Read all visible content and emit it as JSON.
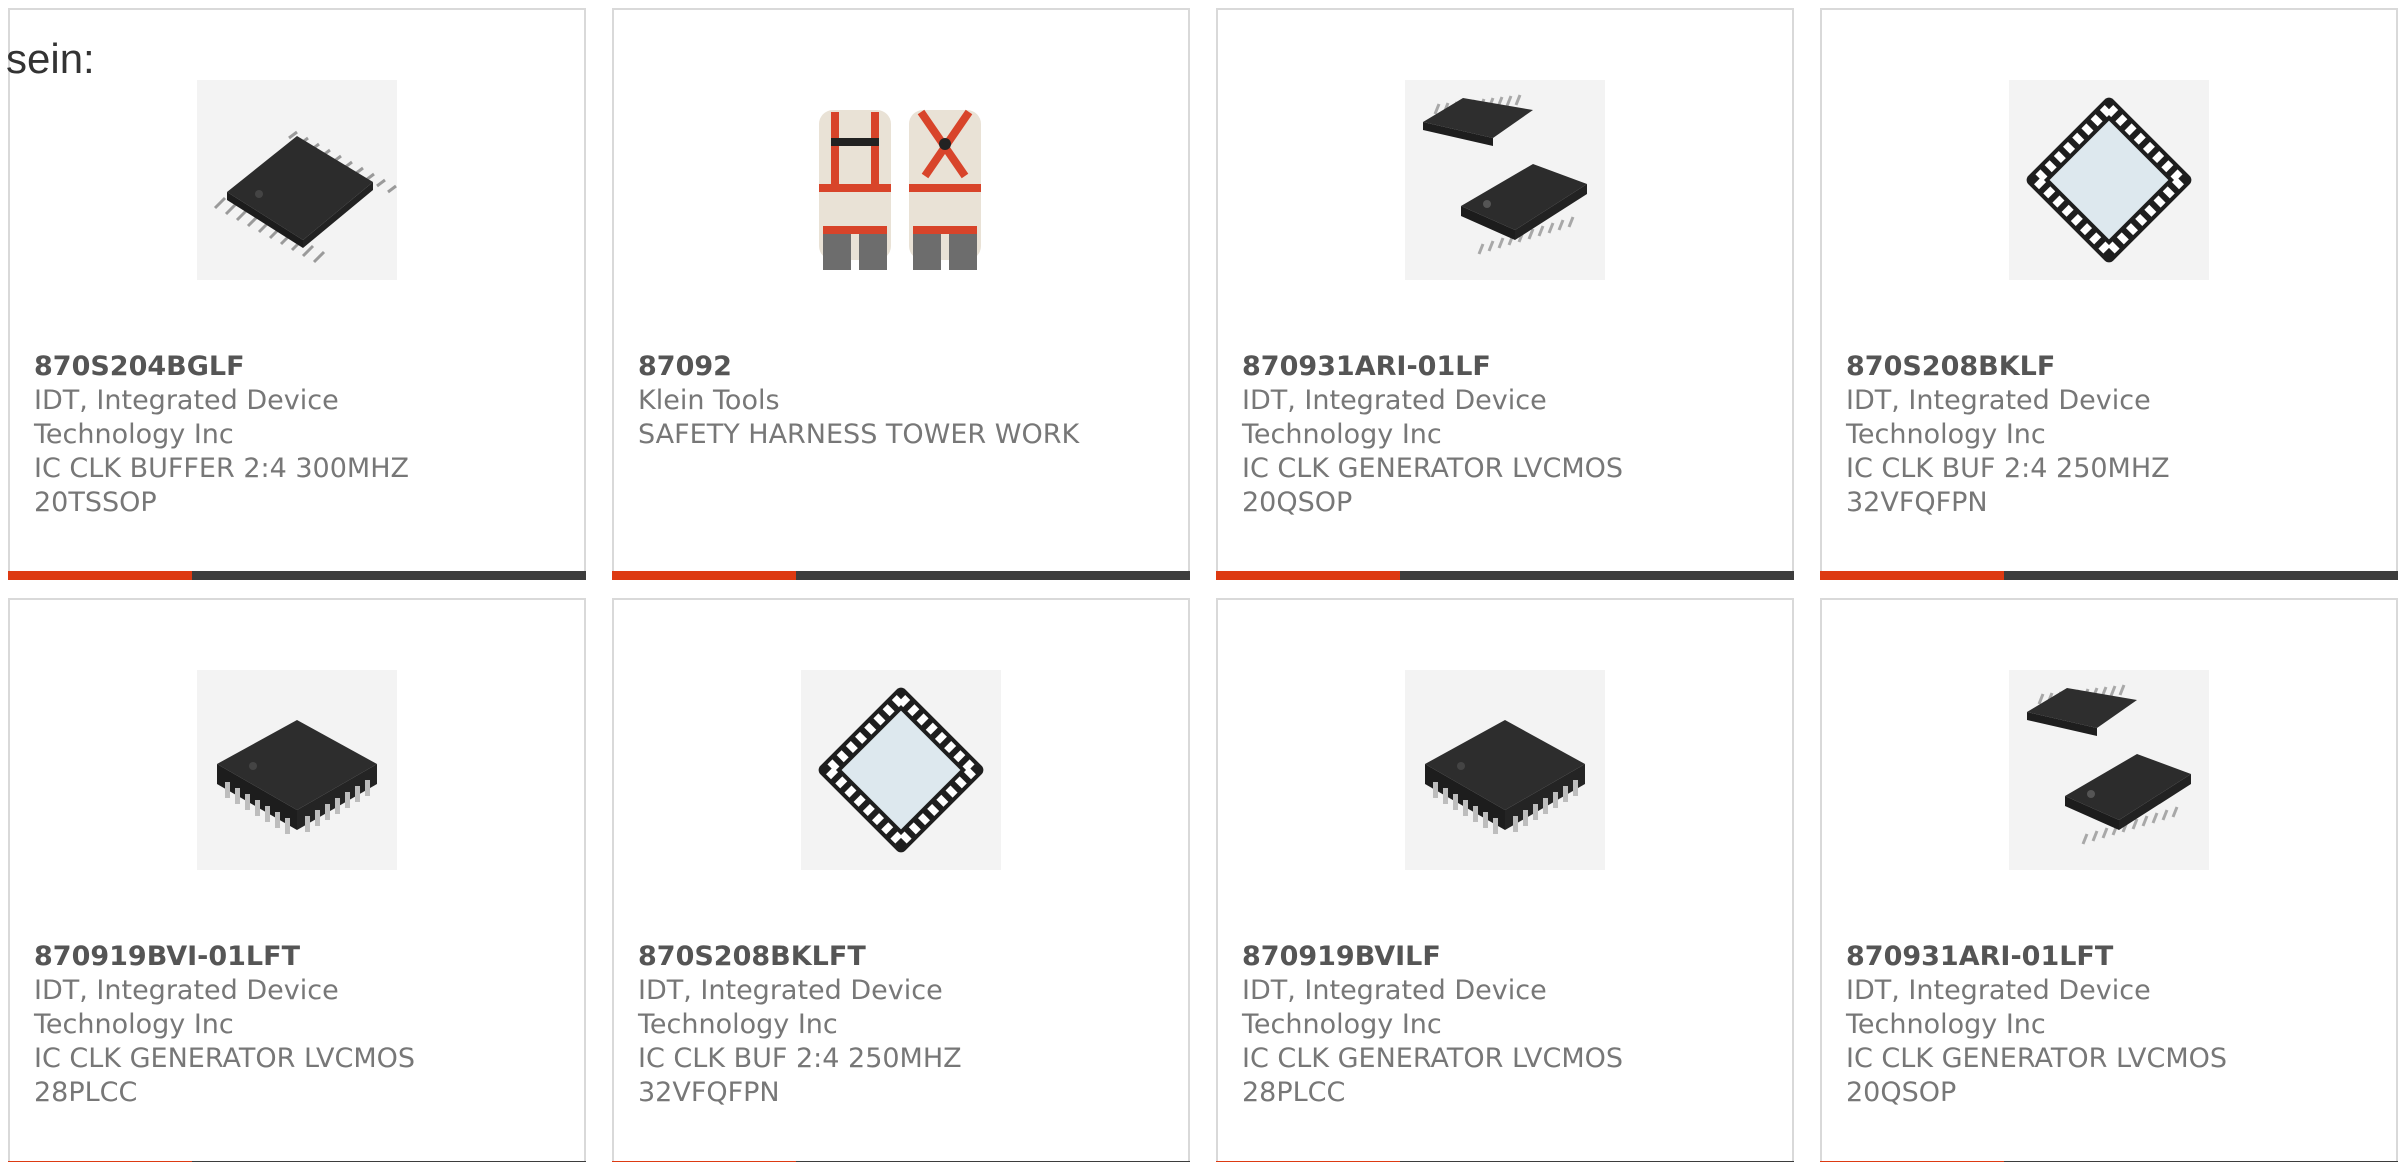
{
  "intro_text": "sein:",
  "colors": {
    "accent": "#dd3a12",
    "bar": "#3d3d3d",
    "border": "#d9d9d9",
    "text": "#777777"
  },
  "products": [
    {
      "mpn": "870S204BGLF",
      "manufacturer_l1": "IDT, Integrated Device",
      "manufacturer_l2": "Technology Inc",
      "desc_l1": "IC CLK BUFFER 2:4 300MHZ",
      "desc_l2": "20TSSOP",
      "image": "tssop-chip-icon"
    },
    {
      "mpn": "87092",
      "manufacturer_l1": "Klein Tools",
      "manufacturer_l2": "",
      "desc_l1": "SAFETY HARNESS TOWER WORK",
      "desc_l2": "",
      "image": "safety-harness-icon"
    },
    {
      "mpn": "870931ARI-01LF",
      "manufacturer_l1": "IDT, Integrated Device",
      "manufacturer_l2": "Technology Inc",
      "desc_l1": "IC CLK GENERATOR LVCMOS",
      "desc_l2": "20QSOP",
      "image": "qsop-chip-icon"
    },
    {
      "mpn": "870S208BKLF",
      "manufacturer_l1": "IDT, Integrated Device",
      "manufacturer_l2": "Technology Inc",
      "desc_l1": "IC CLK BUF 2:4 250MHZ",
      "desc_l2": "32VFQFPN",
      "image": "qfn-chip-icon"
    },
    {
      "mpn": "870919BVI-01LFT",
      "manufacturer_l1": "IDT, Integrated Device",
      "manufacturer_l2": "Technology Inc",
      "desc_l1": "IC CLK GENERATOR LVCMOS",
      "desc_l2": "28PLCC",
      "image": "plcc-chip-icon"
    },
    {
      "mpn": "870S208BKLFT",
      "manufacturer_l1": "IDT, Integrated Device",
      "manufacturer_l2": "Technology Inc",
      "desc_l1": "IC CLK BUF 2:4 250MHZ",
      "desc_l2": "32VFQFPN",
      "image": "qfn-chip-icon"
    },
    {
      "mpn": "870919BVILF",
      "manufacturer_l1": "IDT, Integrated Device",
      "manufacturer_l2": "Technology Inc",
      "desc_l1": "IC CLK GENERATOR LVCMOS",
      "desc_l2": "28PLCC",
      "image": "plcc-chip-icon"
    },
    {
      "mpn": "870931ARI-01LFT",
      "manufacturer_l1": "IDT, Integrated Device",
      "manufacturer_l2": "Technology Inc",
      "desc_l1": "IC CLK GENERATOR LVCMOS",
      "desc_l2": "20QSOP",
      "image": "qsop-chip-icon"
    }
  ]
}
